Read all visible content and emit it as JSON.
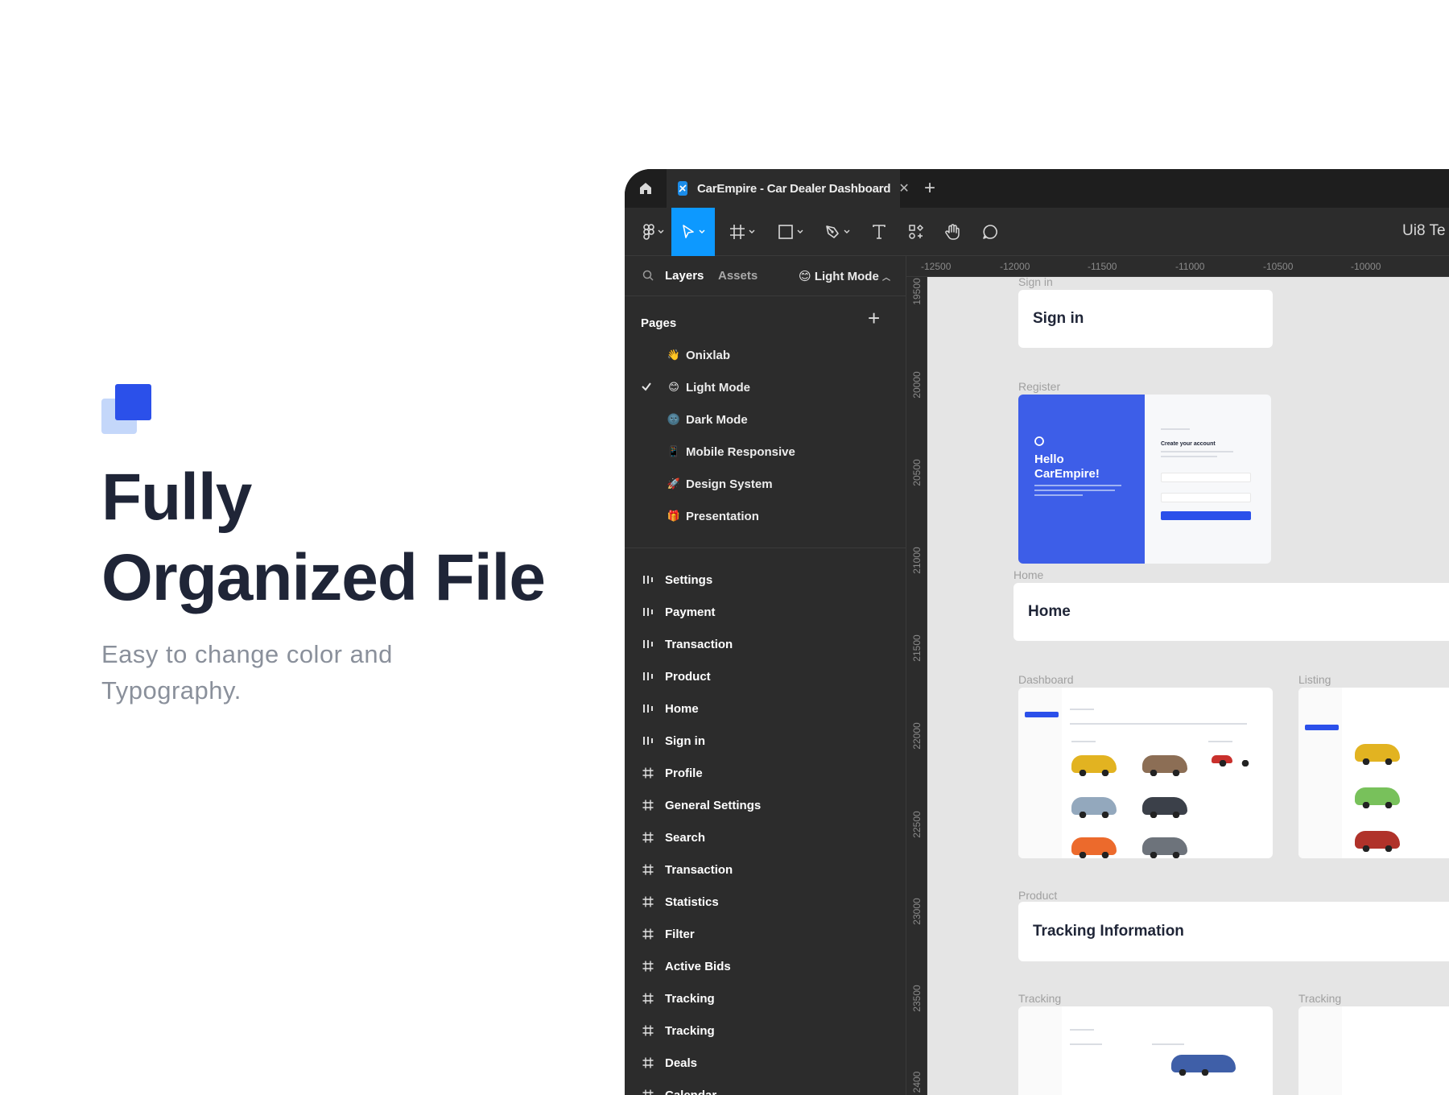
{
  "hero": {
    "title_line1": "Fully",
    "title_line2": "Organized File",
    "subtitle": "Easy to change color and Typography."
  },
  "colors": {
    "brand_blue": "#2b50ea",
    "brand_light": "#c4d7fa",
    "figma_active": "#0d99ff"
  },
  "window": {
    "tab_title": "CarEmpire - Car Dealer Dashboard",
    "team_label": "Ui8 Te",
    "toolbar_icons": [
      "figma-menu-icon",
      "move-tool-icon",
      "frame-tool-icon",
      "shape-tool-icon",
      "pen-tool-icon",
      "text-tool-icon",
      "components-icon",
      "hand-tool-icon",
      "comment-icon"
    ]
  },
  "panel": {
    "layers_tab": "Layers",
    "assets_tab": "Assets",
    "current_page": "Light Mode",
    "pages_title": "Pages",
    "pages": [
      {
        "emoji": "👋",
        "label": "Onixlab",
        "selected": false
      },
      {
        "emoji": "😊",
        "label": "Light Mode",
        "selected": true
      },
      {
        "emoji": "🌚",
        "label": "Dark Mode",
        "selected": false
      },
      {
        "emoji": "📱",
        "label": "Mobile Responsive",
        "selected": false
      },
      {
        "emoji": "🚀",
        "label": "Design System",
        "selected": false
      },
      {
        "emoji": "🎁",
        "label": "Presentation",
        "selected": false
      }
    ],
    "layers": [
      {
        "type": "section",
        "label": "Settings"
      },
      {
        "type": "section",
        "label": "Payment"
      },
      {
        "type": "section",
        "label": "Transaction"
      },
      {
        "type": "section",
        "label": "Product"
      },
      {
        "type": "section",
        "label": "Home"
      },
      {
        "type": "section",
        "label": "Sign in"
      },
      {
        "type": "frame",
        "label": "Profile"
      },
      {
        "type": "frame",
        "label": "General Settings"
      },
      {
        "type": "frame",
        "label": "Search"
      },
      {
        "type": "frame",
        "label": "Transaction"
      },
      {
        "type": "frame",
        "label": "Statistics"
      },
      {
        "type": "frame",
        "label": "Filter"
      },
      {
        "type": "frame",
        "label": "Active Bids"
      },
      {
        "type": "frame",
        "label": "Tracking"
      },
      {
        "type": "frame",
        "label": "Tracking"
      },
      {
        "type": "frame",
        "label": "Deals"
      },
      {
        "type": "frame",
        "label": "Calendar"
      }
    ]
  },
  "rulers": {
    "top": [
      "-12500",
      "-12000",
      "-11500",
      "-11000",
      "-10500",
      "-10000"
    ],
    "left": [
      "19500",
      "20000",
      "20500",
      "21000",
      "21500",
      "22000",
      "22500",
      "23000",
      "23500",
      "2400"
    ]
  },
  "canvas": {
    "signin_label": "Sign in",
    "signin_title": "Sign in",
    "register_label": "Register",
    "register_hello": "Hello CarEmpire!",
    "register_form_title": "Create your account",
    "home_label": "Home",
    "home_title": "Home",
    "dashboard_label": "Dashboard",
    "listing_label": "Listing",
    "product_label": "Product",
    "product_title": "Tracking Information",
    "tracking_label_1": "Tracking",
    "tracking_label_2": "Tracking"
  }
}
